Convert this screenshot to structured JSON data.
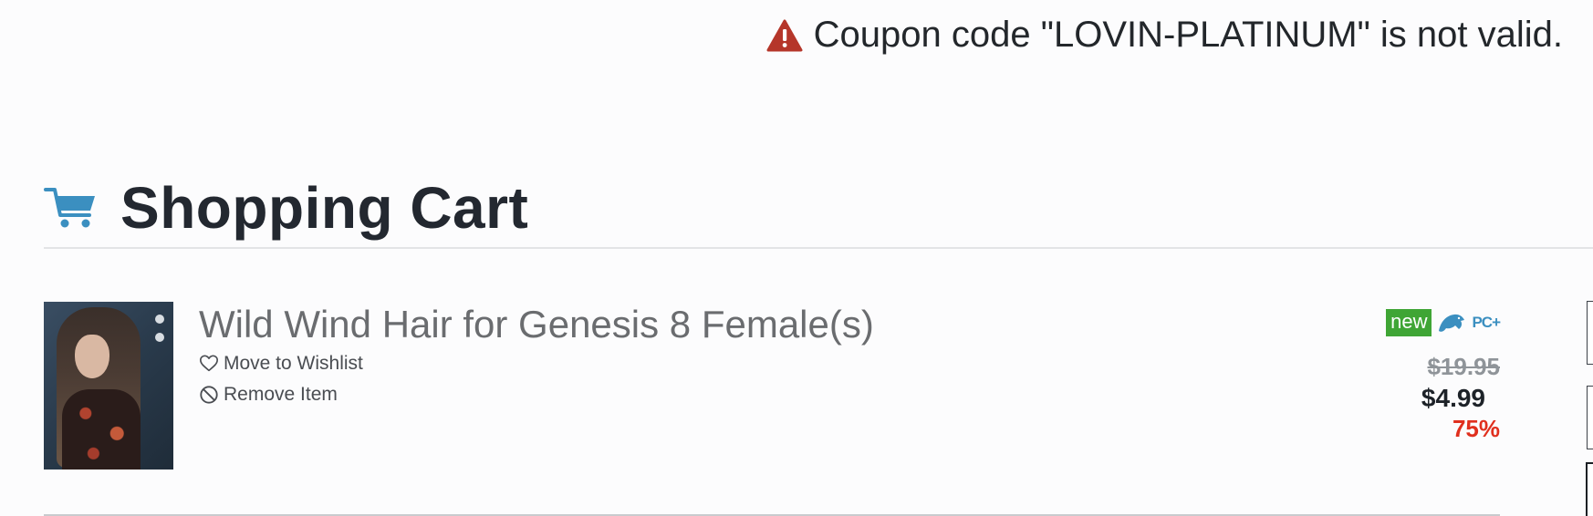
{
  "alert": {
    "icon": "warning-triangle-icon",
    "icon_color": "#b5362a",
    "message": "Coupon code \"LOVIN-PLATINUM\" is not valid."
  },
  "header": {
    "icon": "shopping-cart-icon",
    "icon_color": "#3b8fc0",
    "title": "Shopping Cart"
  },
  "cart": {
    "items": [
      {
        "title": "Wild Wind Hair for Genesis 8 Female(s)",
        "thumbnail": "product-thumbnail",
        "actions": {
          "wishlist_label": "Move to Wishlist",
          "wishlist_icon": "heart-icon",
          "remove_label": "Remove Item",
          "remove_icon": "ban-icon"
        },
        "badges": {
          "new_label": "new",
          "new_color": "#3fa535",
          "dragon_icon": "dragon-icon",
          "pcplus_label": "PC+",
          "pcplus_color": "#3b8fc0"
        },
        "price": {
          "original": "$19.95",
          "current": "$4.99",
          "discount": "75%",
          "discount_color": "#e0301e"
        }
      }
    ]
  }
}
